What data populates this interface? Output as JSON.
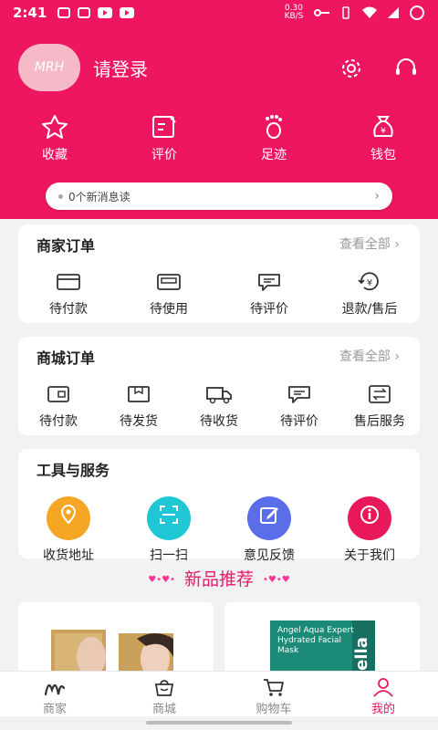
{
  "status_bar": {
    "time": "2:41",
    "speed": "0.30 KB/S"
  },
  "header": {
    "avatar_text": "MRH",
    "login_label": "请登录",
    "quick_links": [
      {
        "label": "收藏",
        "icon": "star-icon"
      },
      {
        "label": "评价",
        "icon": "edit-icon"
      },
      {
        "label": "足迹",
        "icon": "footprint-icon"
      },
      {
        "label": "钱包",
        "icon": "money-bag-icon"
      }
    ]
  },
  "message_bar": {
    "text": "0个新消息读"
  },
  "merchant_orders": {
    "title": "商家订单",
    "view_all": "查看全部",
    "items": [
      {
        "label": "待付款",
        "icon": "card-icon"
      },
      {
        "label": "待使用",
        "icon": "ticket-icon"
      },
      {
        "label": "待评价",
        "icon": "comment-icon"
      },
      {
        "label": "退款/售后",
        "icon": "refund-icon"
      }
    ]
  },
  "mall_orders": {
    "title": "商城订单",
    "view_all": "查看全部",
    "items": [
      {
        "label": "待付款",
        "icon": "wallet-icon"
      },
      {
        "label": "待发货",
        "icon": "box-icon"
      },
      {
        "label": "待收货",
        "icon": "truck-icon"
      },
      {
        "label": "待评价",
        "icon": "comment-icon"
      },
      {
        "label": "售后服务",
        "icon": "exchange-icon"
      }
    ]
  },
  "tools": {
    "title": "工具与服务",
    "items": [
      {
        "label": "收货地址",
        "icon": "location-icon",
        "color": "#f5a623"
      },
      {
        "label": "扫一扫",
        "icon": "scan-icon",
        "color": "#1fc7d4"
      },
      {
        "label": "意见反馈",
        "icon": "feedback-icon",
        "color": "#5b6de8"
      },
      {
        "label": "关于我们",
        "icon": "info-icon",
        "color": "#e8185a"
      }
    ]
  },
  "new_products": {
    "title": "新品推荐"
  },
  "products": [
    {
      "brand": ""
    },
    {
      "brand": "Angel Aqua Expert Hydrated Facial Mask",
      "logo": "ella"
    }
  ],
  "bottom_nav": [
    {
      "label": "商家",
      "icon": "merchant-logo-icon",
      "active": false
    },
    {
      "label": "商城",
      "icon": "shopping-bag-icon",
      "active": false
    },
    {
      "label": "购物车",
      "icon": "cart-icon",
      "active": false
    },
    {
      "label": "我的",
      "icon": "user-icon",
      "active": true
    }
  ],
  "colors": {
    "brand": "#ee1660",
    "background": "#f2f2f2"
  }
}
